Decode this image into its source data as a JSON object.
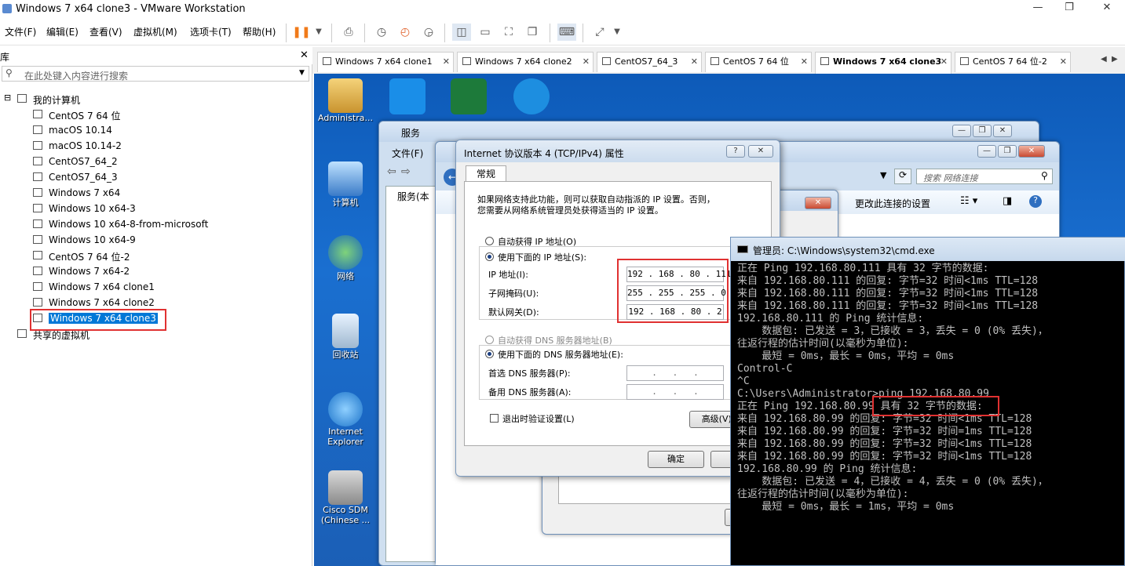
{
  "window": {
    "title": "Windows 7 x64 clone3 - VMware Workstation",
    "min": "—",
    "max": "❐",
    "close": "✕"
  },
  "menu": [
    "文件(F)",
    "编辑(E)",
    "查看(V)",
    "虚拟机(M)",
    "选项卡(T)",
    "帮助(H)"
  ],
  "library": {
    "title": "库",
    "search_placeholder": "在此处键入内容进行搜索",
    "root": "我的计算机",
    "items": [
      "CentOS 7 64 位",
      "macOS 10.14",
      "macOS 10.14-2",
      "CentOS7_64_2",
      "CentOS7_64_3",
      "Windows 7 x64",
      "Windows 10 x64-3",
      "Windows 10 x64-8-from-microsoft",
      "Windows 10 x64-9",
      "CentOS 7 64 位-2",
      "Windows 7 x64-2",
      "Windows 7 x64 clone1",
      "Windows 7 x64 clone2",
      "Windows 7 x64 clone3"
    ],
    "shared": "共享的虚拟机"
  },
  "tabs": [
    "Windows 7 x64 clone1",
    "Windows 7 x64 clone2",
    "CentOS7_64_3",
    "CentOS 7 64 位",
    "Windows 7 x64 clone3",
    "CentOS 7 64 位-2"
  ],
  "desktop": {
    "icons": [
      "Administra...",
      "计算机",
      "网络",
      "回收站",
      "Internet Explorer",
      "Cisco SDM (Chinese ..."
    ]
  },
  "services": {
    "title": "服务",
    "menu_file": "文件(F)",
    "tree": "服务(本"
  },
  "netconn": {
    "search_placeholder": "搜索 网络连接",
    "change_settings": "更改此连接的设置"
  },
  "ipv4": {
    "title": "Internet 协议版本 4 (TCP/IPv4) 属性",
    "tab": "常规",
    "desc1": "如果网络支持此功能，则可以获取自动指派的 IP 设置。否则，",
    "desc2": "您需要从网络系统管理员处获得适当的 IP 设置。",
    "auto_ip": "自动获得 IP 地址(O)",
    "manual_ip": "使用下面的 IP 地址(S):",
    "ip_label": "IP 地址(I):",
    "mask_label": "子网掩码(U):",
    "gw_label": "默认网关(D):",
    "ip": "192 . 168 . 80 . 111",
    "mask": "255 . 255 . 255 . 0",
    "gw": "192 . 168 . 80 . 2",
    "auto_dns": "自动获得 DNS 服务器地址(B)",
    "manual_dns": "使用下面的 DNS 服务器地址(E):",
    "dns1_label": "首选 DNS 服务器(P):",
    "dns2_label": "备用 DNS 服务器(A):",
    "dns_empty": ".   .   .",
    "validate": "退出时验证设置(L)",
    "advanced": "高级(V)...",
    "ok": "确定",
    "help": "?",
    "close": "✕",
    "behind_btn": "确"
  },
  "cmd": {
    "title": "管理员: C:\\Windows\\system32\\cmd.exe",
    "lines": [
      "正在 Ping 192.168.80.111 具有 32 字节的数据:",
      "来自 192.168.80.111 的回复: 字节=32 时间<1ms TTL=128",
      "来自 192.168.80.111 的回复: 字节=32 时间<1ms TTL=128",
      "来自 192.168.80.111 的回复: 字节=32 时间<1ms TTL=128",
      "",
      "192.168.80.111 的 Ping 统计信息:",
      "    数据包: 已发送 = 3，已接收 = 3，丢失 = 0 (0% 丢失)，",
      "往返行程的估计时间(以毫秒为单位):",
      "    最短 = 0ms，最长 = 0ms，平均 = 0ms",
      "Control-C",
      "^C",
      "C:\\Users\\Administrator>ping 192.168.80.99",
      "",
      "正在 Ping 192.168.80.99 具有 32 字节的数据:",
      "来自 192.168.80.99 的回复: 字节=32 时间<1ms TTL=128",
      "来自 192.168.80.99 的回复: 字节=32 时间=1ms TTL=128",
      "来自 192.168.80.99 的回复: 字节=32 时间<1ms TTL=128",
      "来自 192.168.80.99 的回复: 字节=32 时间<1ms TTL=128",
      "",
      "192.168.80.99 的 Ping 统计信息:",
      "    数据包: 已发送 = 4，已接收 = 4，丢失 = 0 (0% 丢失)，",
      "往返行程的估计时间(以毫秒为单位):",
      "    最短 = 0ms，最长 = 1ms，平均 = 0ms"
    ]
  },
  "colors": {
    "highlight": "#e03131",
    "selection": "#0078d7",
    "desktop": "#1a6fd0",
    "pause": "#f07a1a"
  }
}
